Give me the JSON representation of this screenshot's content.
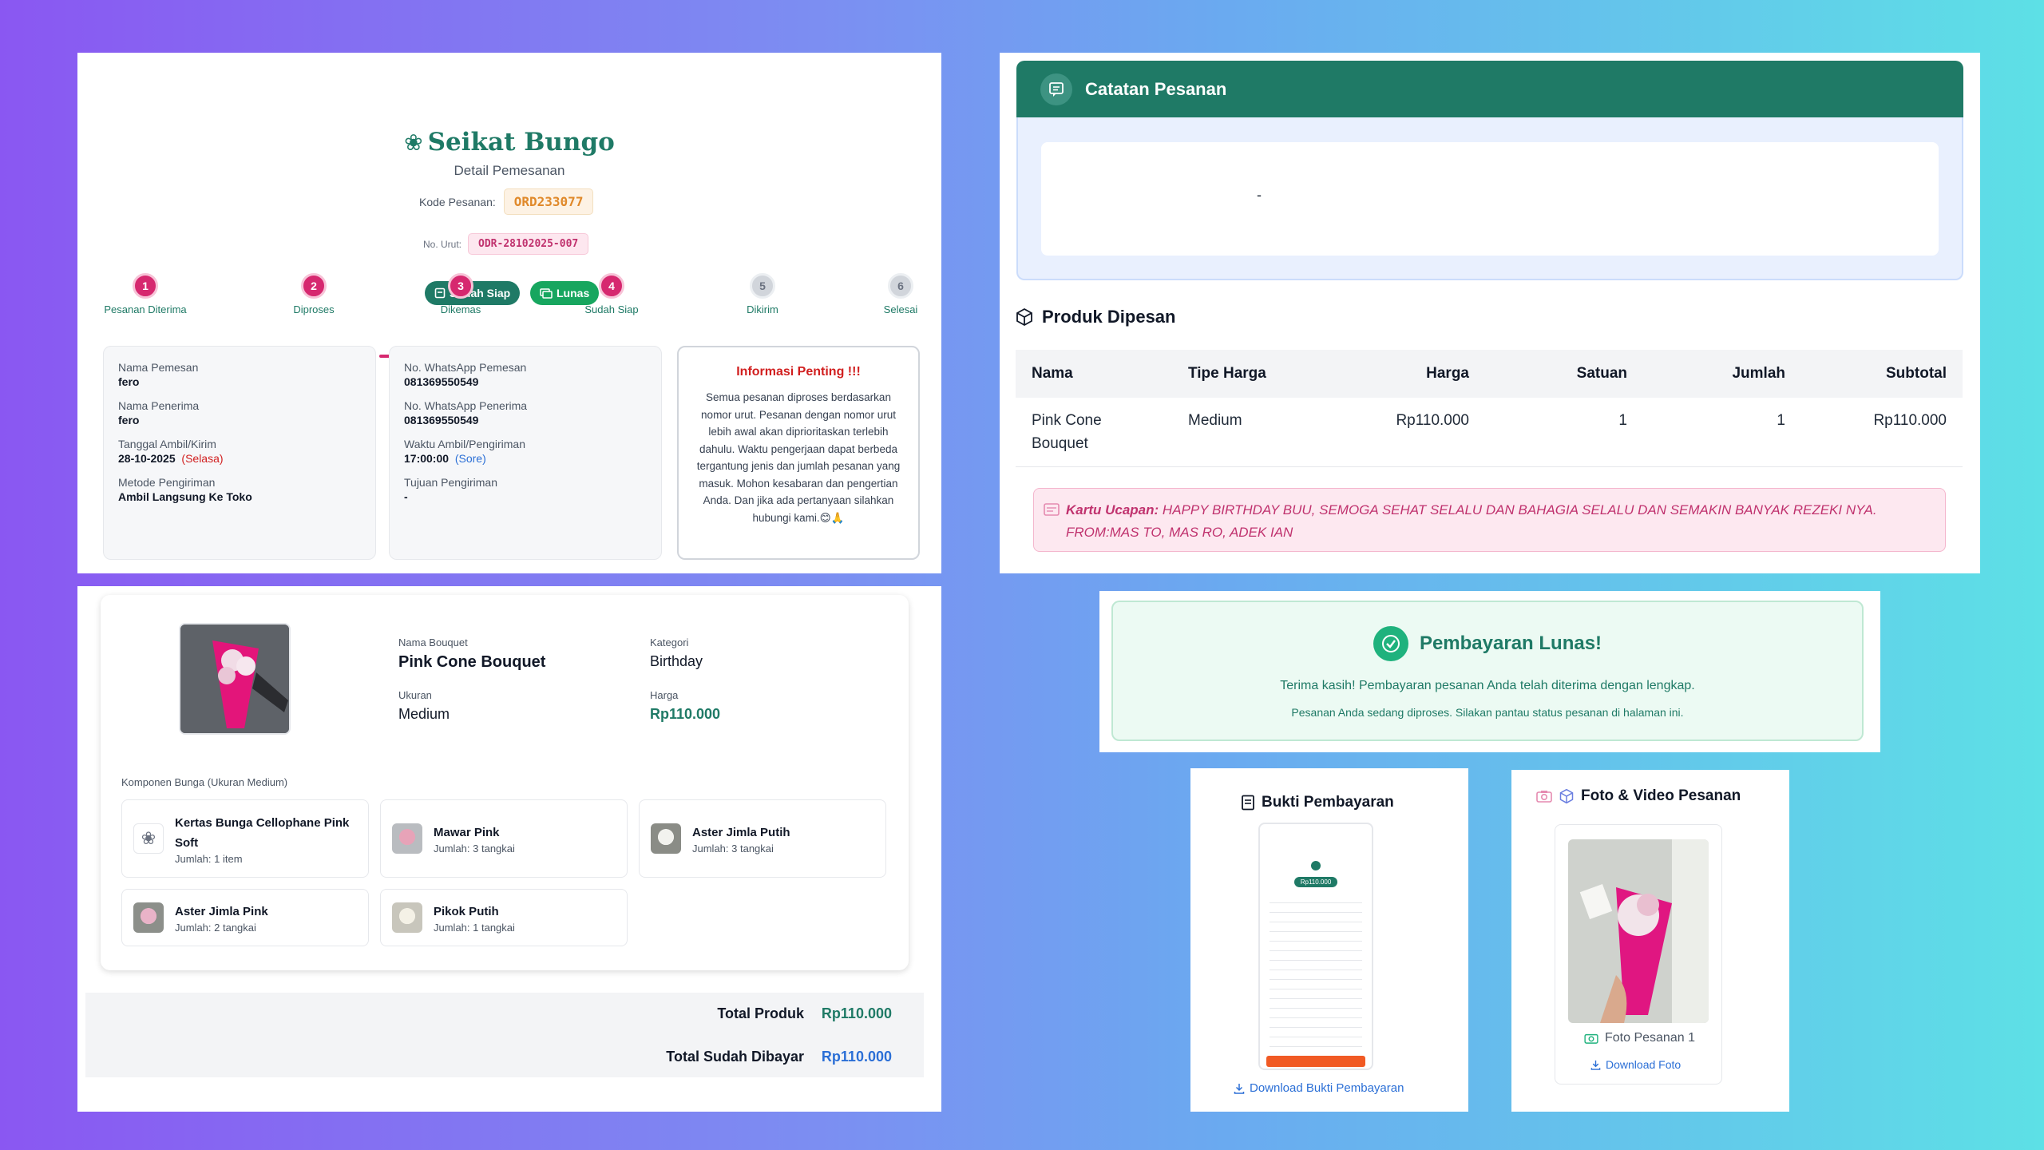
{
  "brand": {
    "name": "Seikat Bungo",
    "subtitle": "Detail Pemesanan"
  },
  "order": {
    "kode_label": "Kode Pesanan:",
    "kode": "ORD233077",
    "urut_label": "No. Urut:",
    "urut": "ODR-28102025-007"
  },
  "badges": {
    "siap": "Sudah Siap",
    "lunas": "Lunas"
  },
  "steps": [
    {
      "n": "1",
      "label": "Pesanan Diterima"
    },
    {
      "n": "2",
      "label": "Diproses"
    },
    {
      "n": "3",
      "label": "Dikemas"
    },
    {
      "n": "4",
      "label": "Sudah Siap"
    },
    {
      "n": "5",
      "label": "Dikirim"
    },
    {
      "n": "6",
      "label": "Selesai"
    }
  ],
  "customer": {
    "nama_pemesan_label": "Nama Pemesan",
    "nama_pemesan": "fero",
    "nama_penerima_label": "Nama Penerima",
    "nama_penerima": "fero",
    "tanggal_label": "Tanggal Ambil/Kirim",
    "tanggal": "28-10-2025",
    "hari": "(Selasa)",
    "metode_label": "Metode Pengiriman",
    "metode": "Ambil Langsung Ke Toko",
    "wa_pemesan_label": "No. WhatsApp Pemesan",
    "wa_pemesan": "081369550549",
    "wa_penerima_label": "No. WhatsApp Penerima",
    "wa_penerima": "081369550549",
    "waktu_label": "Waktu Ambil/Pengiriman",
    "waktu": "17:00:00",
    "waktu_ket": "(Sore)",
    "tujuan_label": "Tujuan Pengiriman",
    "tujuan": "-"
  },
  "info": {
    "title": "Informasi Penting !!!",
    "text": "Semua pesanan diproses berdasarkan nomor urut. Pesanan dengan nomor urut lebih awal akan diprioritaskan terlebih dahulu. Waktu pengerjaan dapat berbeda tergantung jenis dan jumlah pesanan yang masuk. Mohon kesabaran dan pengertian Anda. Dan jika ada pertanyaan silahkan hubungi kami.😊🙏"
  },
  "catatan": {
    "title": "Catatan Pesanan",
    "text": "-"
  },
  "produk": {
    "title": "Produk Dipesan",
    "headers": [
      "Nama",
      "Tipe Harga",
      "Harga",
      "Satuan",
      "Jumlah",
      "Subtotal"
    ],
    "rows": [
      [
        "Pink Cone Bouquet",
        "Medium",
        "Rp110.000",
        "1",
        "1",
        "Rp110.000"
      ]
    ],
    "kartu_label": "Kartu Ucapan:",
    "kartu_text": "HAPPY BIRTHDAY BUU, SEMOGA SEHAT SELALU DAN BAHAGIA SELALU DAN SEMAKIN BANYAK REZEKI NYA. FROM:MAS TO, MAS RO, ADEK IAN"
  },
  "bouquet": {
    "nama_label": "Nama Bouquet",
    "nama": "Pink Cone Bouquet",
    "kategori_label": "Kategori",
    "kategori": "Birthday",
    "ukuran_label": "Ukuran",
    "ukuran": "Medium",
    "harga_label": "Harga",
    "harga": "Rp110.000",
    "komponen_title": "Komponen Bunga (Ukuran Medium)",
    "komponen": [
      {
        "name": "Kertas Bunga Cellophane Pink Soft",
        "qty": "Jumlah: 1 item"
      },
      {
        "name": "Mawar Pink",
        "qty": "Jumlah: 3 tangkai"
      },
      {
        "name": "Aster Jimla Putih",
        "qty": "Jumlah: 3 tangkai"
      },
      {
        "name": "Aster Jimla Pink",
        "qty": "Jumlah: 2 tangkai"
      },
      {
        "name": "Pikok Putih",
        "qty": "Jumlah: 1 tangkai"
      }
    ]
  },
  "totals": {
    "produk_label": "Total Produk",
    "produk": "Rp110.000",
    "dibayar_label": "Total Sudah Dibayar",
    "dibayar": "Rp110.000"
  },
  "pembayaran": {
    "title": "Pembayaran Lunas!",
    "msg1": "Terima kasih! Pembayaran pesanan Anda telah diterima dengan lengkap.",
    "msg2": "Pesanan Anda sedang diproses. Silakan pantau status pesanan di halaman ini."
  },
  "bukti": {
    "title": "Bukti Pembayaran",
    "download": "Download Bukti Pembayaran",
    "amount": "Rp110.000"
  },
  "media": {
    "title": "Foto & Video Pesanan",
    "caption": "Foto Pesanan 1",
    "download": "Download Foto"
  },
  "colors": {
    "primary": "#1f7a66",
    "accent": "#d6286f",
    "success": "#1fb27d",
    "link": "#2b6fd6"
  }
}
